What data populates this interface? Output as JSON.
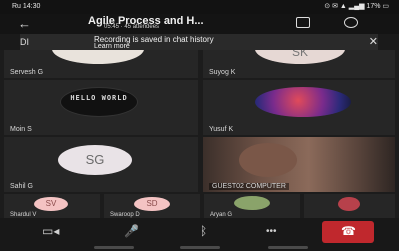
{
  "status_bar": {
    "time": "Ru 14:30",
    "right_indicators": "⊙ ✉ ▲ ▂▄▆ 17% ▭"
  },
  "header": {
    "title": "Agile Process and H...",
    "subtitle": "05:45 · 45 attendees",
    "back_icon": "back-arrow-icon",
    "chat_icon": "chat-icon",
    "participants_icon": "participants-icon"
  },
  "banner": {
    "left_text": "DI",
    "message": "Recording is saved in chat history",
    "link": "Learn more",
    "close": "✕"
  },
  "participants": {
    "top_left": {
      "name": "Servesh G",
      "initials": ""
    },
    "top_right": {
      "name": "Suyog K",
      "initials": "SK"
    },
    "mid_left": {
      "name": "Moin S",
      "avatar_text": "HELLO WORLD"
    },
    "mid_right": {
      "name": "Yusuf K"
    },
    "low_left": {
      "name": "Sahil G",
      "initials": "SG"
    },
    "low_right": {
      "name": "GUEST02 COMPUTER"
    }
  },
  "strip": [
    {
      "name": "Shardul V",
      "initials": "SV",
      "color": "#f4c3c3"
    },
    {
      "name": "Swaroop D",
      "initials": "SD",
      "color": "#f4c3c3"
    },
    {
      "name": "Aryan G",
      "initials": "",
      "color": "#8aa36a"
    },
    {
      "name": "",
      "initials": "",
      "color": "#b7414b"
    }
  ],
  "controls": {
    "camera": "▭◂",
    "mic": "🎤",
    "bluetooth": "ᛒ",
    "more": "•••",
    "end_call": "☎"
  },
  "colors": {
    "end_call": "#c0282d",
    "tile_bg": "#262626"
  }
}
